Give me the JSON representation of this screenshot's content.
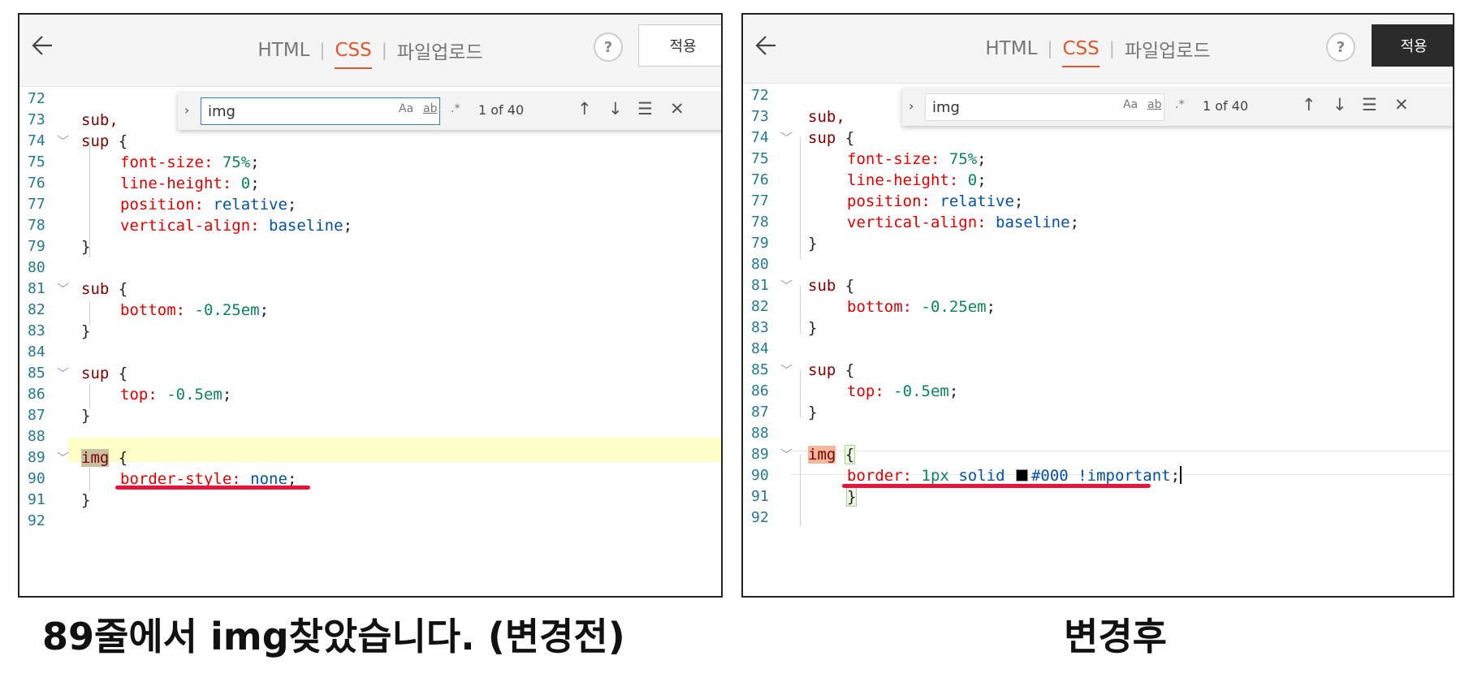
{
  "panels": {
    "before": {
      "tabs": [
        "HTML",
        "CSS",
        "파일업로드"
      ],
      "active_tab": "CSS",
      "help_label": "?",
      "apply_label": "적용",
      "find": {
        "query": "img",
        "count": "1 of 40",
        "opt_case": "Aa",
        "opt_word": "ab",
        "opt_regex": ".*"
      },
      "lines": [
        {
          "n": "72"
        },
        {
          "n": "73"
        },
        {
          "n": "74"
        },
        {
          "n": "75"
        },
        {
          "n": "76"
        },
        {
          "n": "77"
        },
        {
          "n": "78"
        },
        {
          "n": "79"
        },
        {
          "n": "80"
        },
        {
          "n": "81"
        },
        {
          "n": "82"
        },
        {
          "n": "83"
        },
        {
          "n": "84"
        },
        {
          "n": "85"
        },
        {
          "n": "86"
        },
        {
          "n": "87"
        },
        {
          "n": "88"
        },
        {
          "n": "89"
        },
        {
          "n": "90"
        },
        {
          "n": "91"
        },
        {
          "n": "92"
        }
      ],
      "code": {
        "l73": "sub,",
        "l74_sel": "sup",
        "open": "{",
        "close": "}",
        "l75_prop": "font-size:",
        "l75_val": "75%",
        "l76_prop": "line-height:",
        "l76_val": "0",
        "l77_prop": "position:",
        "l77_val": "relative",
        "l78_prop": "vertical-align:",
        "l78_val": "baseline",
        "l81_sel": "sub",
        "l82_prop": "bottom:",
        "l82_val": "-0.25em",
        "l85_sel": "sup",
        "l86_prop": "top:",
        "l86_val": "-0.5em",
        "l89_sel": "img",
        "l90_prop": "border-style:",
        "l90_val": "none"
      }
    },
    "after": {
      "tabs": [
        "HTML",
        "CSS",
        "파일업로드"
      ],
      "active_tab": "CSS",
      "help_label": "?",
      "apply_label": "적용",
      "find": {
        "query": "img",
        "count": "1 of 40",
        "opt_case": "Aa",
        "opt_word": "ab",
        "opt_regex": ".*"
      },
      "code": {
        "l90_prop": "border:",
        "l90_num": "1px",
        "l90_word": "solid",
        "l90_hex": "#000",
        "l90_imp": "!important"
      }
    }
  },
  "captions": {
    "left": "89줄에서 img찾았습니다. (변경전)",
    "right": "변경후"
  },
  "colors": {
    "accent": "#e2562e",
    "underline": "#e8143a",
    "line_highlight": "#ffffc8",
    "apply_dark": "#2b2b2b"
  }
}
